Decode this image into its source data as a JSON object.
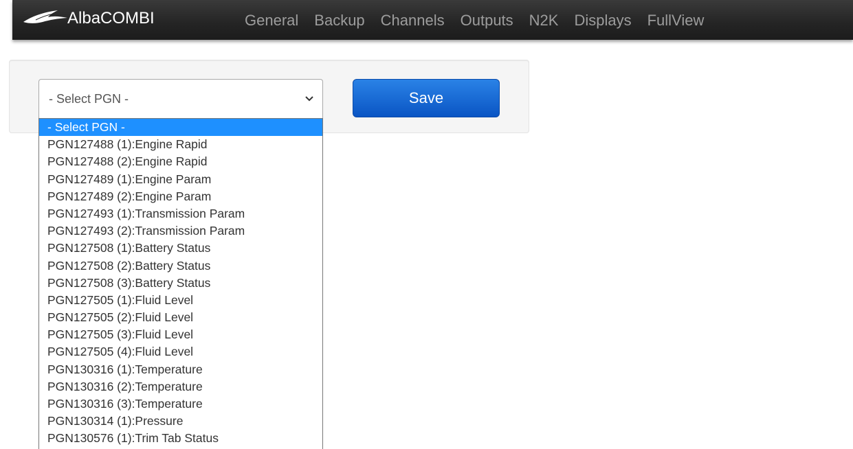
{
  "navbar": {
    "brand": "AlbaCOMBI",
    "links": [
      "General",
      "Backup",
      "Channels",
      "Outputs",
      "N2K",
      "Displays",
      "FullView"
    ]
  },
  "form": {
    "select_value": "- Select PGN -",
    "save_label": "Save"
  },
  "dropdown": {
    "selected_index": 0,
    "options": [
      "- Select PGN -",
      "PGN127488 (1):Engine Rapid",
      "PGN127488 (2):Engine Rapid",
      "PGN127489 (1):Engine Param",
      "PGN127489 (2):Engine Param",
      "PGN127493 (1):Transmission Param",
      "PGN127493 (2):Transmission Param",
      "PGN127508 (1):Battery Status",
      "PGN127508 (2):Battery Status",
      "PGN127508 (3):Battery Status",
      "PGN127505 (1):Fluid Level",
      "PGN127505 (2):Fluid Level",
      "PGN127505 (3):Fluid Level",
      "PGN127505 (4):Fluid Level",
      "PGN130316 (1):Temperature",
      "PGN130316 (2):Temperature",
      "PGN130316 (3):Temperature",
      "PGN130314 (1):Pressure",
      "PGN130576 (1):Trim Tab Status"
    ]
  },
  "colors": {
    "navbar_bg": "#222222",
    "nav_link": "#9d9d9d",
    "save_button": "#0a55c4",
    "option_highlight": "#1e90ff"
  },
  "icons": {
    "brand": "bird-logo-icon",
    "select": "chevron-down-icon"
  }
}
